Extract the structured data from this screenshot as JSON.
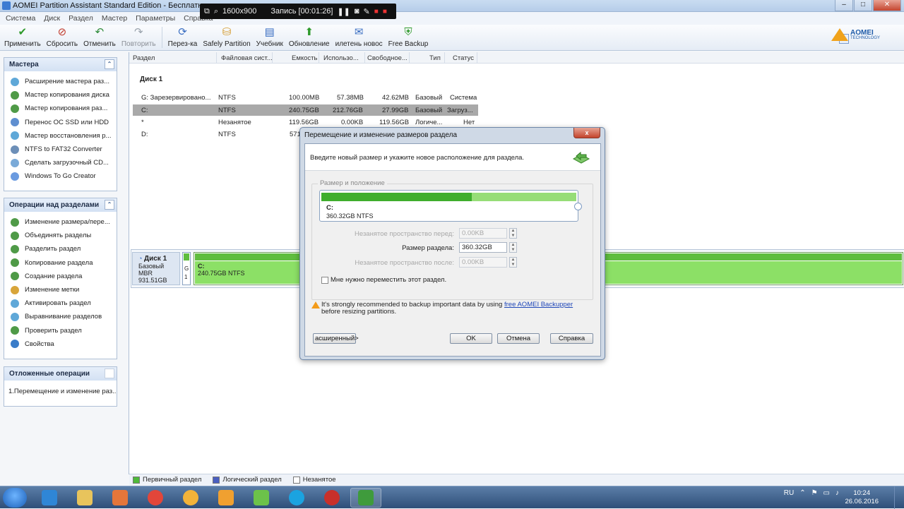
{
  "window": {
    "title": "AOMEI Partition Assistant Standard Edition - Бесплатно для ч"
  },
  "recorder": {
    "resolution": "1600x900",
    "status": "Запись [00:01:26]"
  },
  "menu": [
    "Система",
    "Диск",
    "Раздел",
    "Мастер",
    "Параметры",
    "Справка"
  ],
  "toolbar": {
    "items": [
      {
        "label": "Применить",
        "icon": "checkmark-icon",
        "color": "#2f9a2c"
      },
      {
        "label": "Сбросить",
        "icon": "discard-icon",
        "color": "#c0392b"
      },
      {
        "label": "Отменить",
        "icon": "undo-icon",
        "color": "#2e8b3a"
      },
      {
        "label": "Повторить",
        "icon": "redo-icon",
        "color": "#9aa3ad"
      },
      {
        "label": "Перез-ка",
        "icon": "reload-icon",
        "color": "#3a6ec2"
      },
      {
        "label": "Safely Partition",
        "icon": "safe-partition-icon",
        "color": "#d49a2c"
      },
      {
        "label": "Учебник",
        "icon": "tutorial-icon",
        "color": "#3a6ec2"
      },
      {
        "label": "Обновление",
        "icon": "upgrade-icon",
        "color": "#2f9a2c"
      },
      {
        "label": "илетень новос",
        "icon": "newsletter-icon",
        "color": "#3a6ec2"
      },
      {
        "label": "Free Backup",
        "icon": "backup-icon",
        "color": "#2f9a2c"
      }
    ],
    "brand": "AOMEI",
    "brand_sub": "TECHNOLOGY"
  },
  "wizards_panel": {
    "title": "Мастера",
    "items": [
      "Расширение мастера раз...",
      "Мастер копирования диска",
      "Мастер копирования раз...",
      "Перенос ОС SSD или HDD",
      "Мастер восстановления р...",
      "NTFS to FAT32 Converter",
      "Сделать загрузочный CD...",
      "Windows To Go Creator"
    ]
  },
  "operations_panel": {
    "title": "Операции над разделами",
    "items": [
      "Изменение размера/пере...",
      "Объединять разделы",
      "Разделить раздел",
      "Копирование раздела",
      "Создание раздела",
      "Изменение метки",
      "Активировать раздел",
      "Выравнивание разделов",
      "Проверить раздел",
      "Свойства"
    ]
  },
  "pending_panel": {
    "title": "Отложенные операции",
    "items": [
      "1.Перемещение и изменение раз..."
    ]
  },
  "table": {
    "headers": [
      "Раздел",
      "Файловая сист...",
      "Емкость",
      "Использо...",
      "Свободное...",
      "Тип",
      "Статус"
    ],
    "disk_label": "Диск 1",
    "rows": [
      {
        "name": "G: Зарезервировано...",
        "fs": "NTFS",
        "cap": "100.00MB",
        "used": "57.38MB",
        "free": "42.62MB",
        "type": "Базовый",
        "status": "Система"
      },
      {
        "name": "C:",
        "fs": "NTFS",
        "cap": "240.75GB",
        "used": "212.76GB",
        "free": "27.99GB",
        "type": "Базовый",
        "status": "Загруз..."
      },
      {
        "name": "*",
        "fs": "Незанятое",
        "cap": "119.56GB",
        "used": "0.00KB",
        "free": "119.56GB",
        "type": "Логиче...",
        "status": "Нет"
      },
      {
        "name": "D:",
        "fs": "NTFS",
        "cap": "571",
        "used": "",
        "free": "",
        "type": "",
        "status": ""
      }
    ]
  },
  "diskmap": {
    "disk_name": "Диск 1",
    "disk_type": "Базовый MBR",
    "disk_size": "931.51GB",
    "small_seg_label": "G",
    "small_seg_num": "1",
    "c_label": "C:",
    "c_info": "240.75GB NTFS"
  },
  "legend": [
    "Первичный раздел",
    "Логический раздел",
    "Незанятое"
  ],
  "dialog": {
    "title": "Перемещение и изменение размеров раздела",
    "close": "x",
    "description": "Введите новый размер и укажите новое расположение для раздела.",
    "group_title": "Размер и положение",
    "partition_name": "C:",
    "partition_size": "360.32GB NTFS",
    "used_fraction": 0.59,
    "before_label": "Незанятое пространство перед:",
    "before_value": "0.00KB",
    "size_label": "Размер раздела:",
    "size_value": "360.32GB",
    "after_label": "Незанятое пространство после:",
    "after_value": "0.00KB",
    "move_checkbox": "Мне нужно переместить этот раздел.",
    "warning_pre": "It's strongly recommended to backup important data by using ",
    "warning_link": "free AOMEI Backupper",
    "warning_post": " before resizing partitions.",
    "advanced": "асширенный>",
    "ok": "OK",
    "cancel": "Отмена",
    "help": "Справка"
  },
  "taskbar": {
    "lang": "RU",
    "time": "10:24",
    "date": "26.06.2016"
  }
}
